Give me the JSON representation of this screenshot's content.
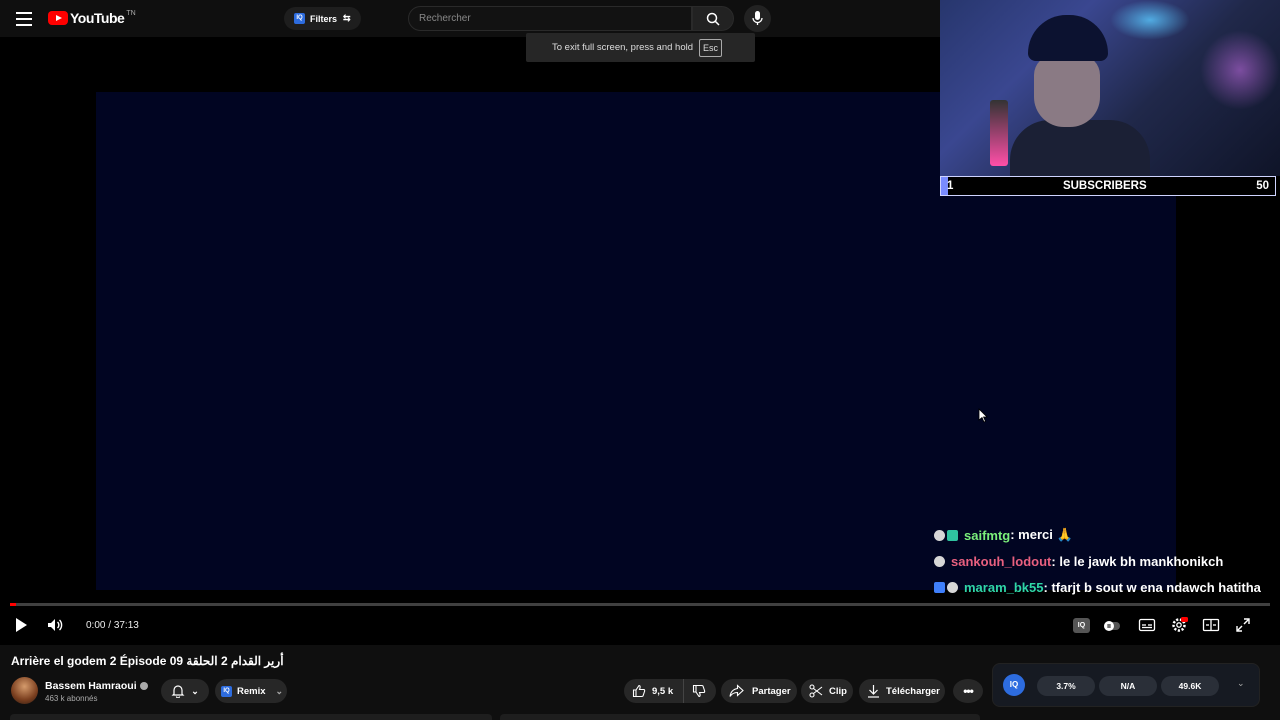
{
  "header": {
    "logo_text": "YouTube",
    "logo_superscript": "TN",
    "filters_badge": "IQ",
    "filters_label": "Filters",
    "search_placeholder": "Rechercher"
  },
  "toast": {
    "text": "To exit full screen, press and hold",
    "key": "Esc"
  },
  "overlay": {
    "subscriber_goal": {
      "left_value": "1",
      "label": "SUBSCRIBERS",
      "right_value": "50",
      "fill_fraction": 0.02
    },
    "chat": [
      {
        "user": "saifmtg",
        "user_color": "#7bf07b",
        "message": ": merci 🙏"
      },
      {
        "user": "sankouh_lodout",
        "user_color": "#e8607f",
        "message": ": le le jawk bh mankhonikch"
      },
      {
        "user": "maram_bk55",
        "user_color": "#2fd6a7",
        "message": ": tfarjt b sout w ena ndawch hatitha"
      }
    ]
  },
  "player": {
    "current_time": "0:00",
    "separator": " / ",
    "duration": "37:13",
    "progress_fraction": 0.005,
    "iq_button": "IQ"
  },
  "video": {
    "title": "Arrière el godem 2 Épisode 09 أرير القدام 2 الحلقة",
    "channel_name": "Bassem Hamraoui",
    "subscribers": "463 k abonnés",
    "remix_badge": "IQ",
    "remix_label": "Remix",
    "like_count": "9,5 k",
    "share_label": "Partager",
    "clip_label": "Clip",
    "download_label": "Télécharger"
  },
  "iq_panel": {
    "logo": "IQ",
    "stats": [
      "3.7%",
      "N/A",
      "49.6K"
    ]
  }
}
